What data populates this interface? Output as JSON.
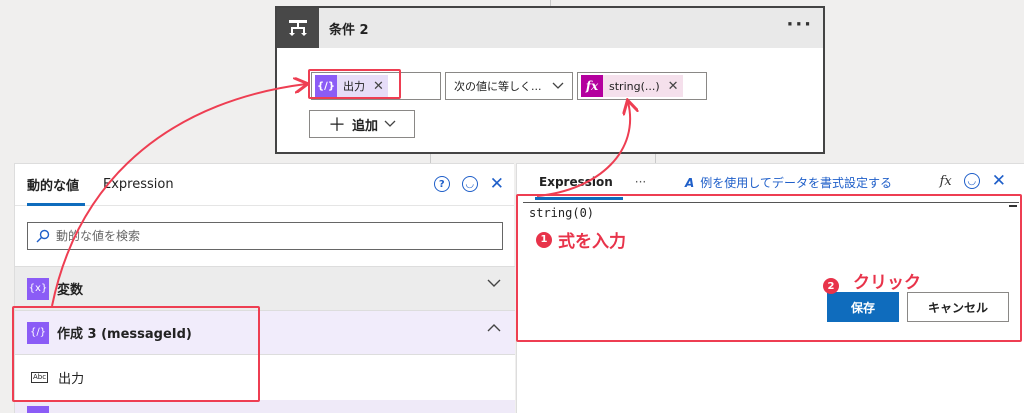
{
  "condition": {
    "title": "条件 2",
    "more": "···",
    "left_token": "出力",
    "operator": "次の値に等しく...",
    "right_token": "string(...)",
    "add_button": "追加"
  },
  "dynamic_panel": {
    "tabs": [
      "動的な値",
      "Expression"
    ],
    "search_placeholder": "動的な値を検索",
    "sections": [
      {
        "label": "変数",
        "icon": "{x}"
      },
      {
        "label": "作成 3 (messageId)",
        "icon": "{∕}"
      }
    ],
    "item_label": "出力"
  },
  "expression_panel": {
    "tab": "Expression",
    "dots": "···",
    "example_link": "例を使用してデータを書式設定する",
    "expression": "string(0)",
    "save": "保存",
    "cancel": "キャンセル"
  },
  "annotations": {
    "step1_num": "1",
    "step1_text": "式を入力",
    "step2_num": "2",
    "step2_text": "クリック"
  },
  "colors": {
    "accent": "#0f6cbd",
    "annotation": "#ee3e52",
    "token_purple": "#8b5cf6",
    "token_magenta": "#b4009e"
  }
}
